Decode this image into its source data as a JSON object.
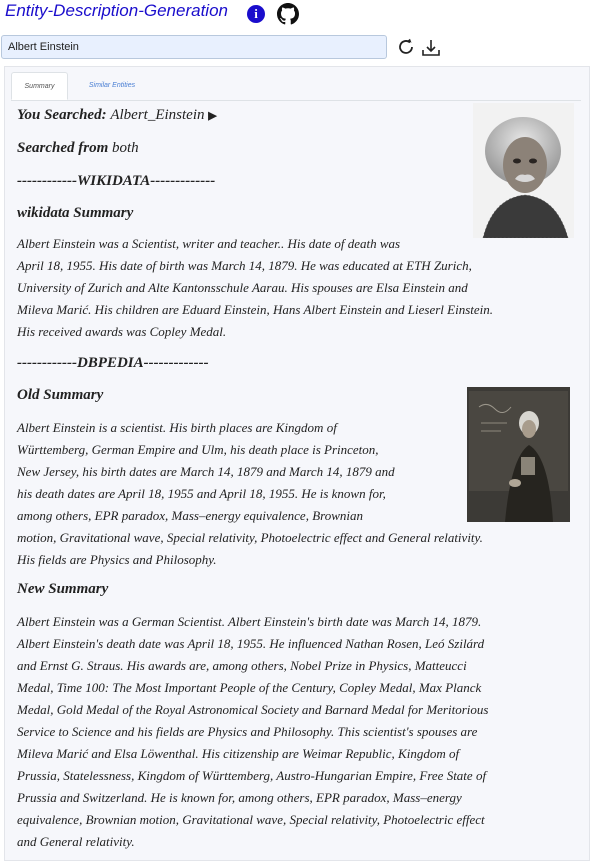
{
  "header": {
    "title": "Entity-Description-Generation",
    "info_icon": "info-icon",
    "github_icon": "github-icon"
  },
  "search": {
    "value": "Albert Einstein",
    "refresh_icon": "refresh-icon",
    "download_icon": "download-icon"
  },
  "tabs": [
    {
      "label": "Summary",
      "active": true
    },
    {
      "label": "Similar Entities",
      "active": false
    }
  ],
  "summary": {
    "you_searched_label": "You Searched:",
    "you_searched_value": "Albert_Einstein",
    "play_icon": "play-icon",
    "searched_from_label": "Searched from",
    "searched_from_value": "both",
    "wikidata_divider": "------------WIKIDATA-------------",
    "wikidata_heading": "wikidata Summary",
    "wikidata_lines": [
      "Albert Einstein was a Scientist, writer and teacher.. His date of death was",
      "April 18, 1955. His date of birth was March 14, 1879. He was educated at ETH Zurich,",
      "University of Zurich and Alte Kantonsschule Aarau. His spouses are Elsa Einstein and",
      "Mileva Marić. His children are Eduard Einstein, Hans Albert Einstein and Lieserl Einstein.",
      "His received awards was Copley Medal."
    ],
    "dbpedia_divider": "------------DBPEDIA-------------",
    "old_heading": "Old Summary",
    "old_lines": [
      "Albert Einstein is a scientist. His birth places are Kingdom of",
      "Württemberg, German Empire and Ulm, his death place is Princeton,",
      "New Jersey, his birth dates are March 14, 1879 and March 14, 1879 and",
      "his death dates are April 18, 1955 and April 18, 1955. He is known for,",
      "among others, EPR paradox, Mass–energy equivalence, Brownian",
      "motion, Gravitational wave, Special relativity, Photoelectric effect and General relativity.",
      "His fields are Physics and Philosophy."
    ],
    "new_heading": "New Summary",
    "new_lines": [
      "Albert Einstein was a German Scientist. Albert Einstein's birth date was March 14, 1879.",
      "Albert Einstein's death date was April 18, 1955. He influenced Nathan Rosen, Leó Szilárd",
      "and Ernst G. Straus. His awards are, among others, Nobel Prize in Physics, Matteucci",
      "Medal, Time 100: The Most Important People of the Century, Copley Medal, Max Planck",
      "Medal, Gold Medal of the Royal Astronomical Society and Barnard Medal for Meritorious",
      "Service to Science and his fields are Physics and Philosophy. This scientist's spouses are",
      "Mileva Marić and Elsa Löwenthal. His citizenship are Weimar Republic, Kingdom of",
      "Prussia, Statelessness, Kingdom of Württemberg, Austro-Hungarian Empire, Free State of",
      "Prussia and Switzerland. He is known for, among others, EPR paradox, Mass–energy",
      "equivalence, Brownian motion, Gravitational wave, Special relativity, Photoelectric effect",
      "and General relativity."
    ]
  },
  "colors": {
    "title": "#1a0dcc",
    "search_bg": "#e8f0fe",
    "panel_bg": "#f6f7fb",
    "tab_inactive": "#4a7fd4"
  }
}
